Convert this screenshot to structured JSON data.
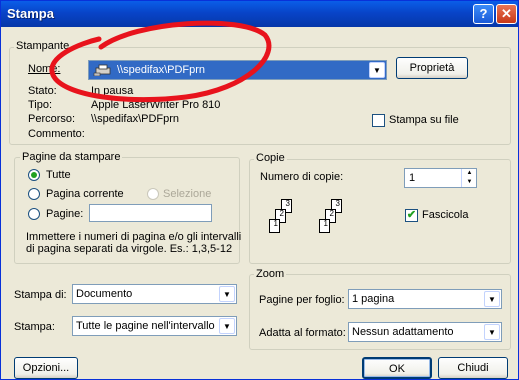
{
  "window": {
    "title": "Stampa"
  },
  "titlebar": {
    "help": "?",
    "close": "✕"
  },
  "printer": {
    "group_label": "Stampante",
    "name_label": "Nome:",
    "name_value": "\\\\spedifax\\PDFprn",
    "properties_button": "Proprietà",
    "status_label": "Stato:",
    "status_value": "In pausa",
    "type_label": "Tipo:",
    "type_value": "Apple LaserWriter Pro 810",
    "path_label": "Percorso:",
    "path_value": "\\\\spedifax\\PDFprn",
    "comment_label": "Commento:",
    "print_to_file_label": "Stampa su file",
    "print_to_file_checked": false
  },
  "range": {
    "group_label": "Pagine da stampare",
    "all_label": "Tutte",
    "current_page_label": "Pagina corrente",
    "selection_label": "Selezione",
    "pages_label": "Pagine:",
    "pages_value": "",
    "hint_line1": "Immettere i numeri di pagina e/o gli intervalli",
    "hint_line2": "di pagina separati da virgole. Es.: 1,3,5-12",
    "selected": "all"
  },
  "copies": {
    "group_label": "Copie",
    "count_label": "Numero di copie:",
    "count_value": "1",
    "collate_label": "Fascicola",
    "collate_checked": true,
    "page_numbers": [
      "1",
      "2",
      "3"
    ]
  },
  "print_what": {
    "label": "Stampa di:",
    "value": "Documento"
  },
  "print_option": {
    "label": "Stampa:",
    "value": "Tutte le pagine nell'intervallo"
  },
  "zoom": {
    "group_label": "Zoom",
    "pages_per_sheet_label": "Pagine per foglio:",
    "pages_per_sheet_value": "1 pagina",
    "scale_label": "Adatta al formato:",
    "scale_value": "Nessun adattamento"
  },
  "buttons": {
    "options": "Opzioni...",
    "ok": "OK",
    "cancel": "Chiudi"
  },
  "annotation": {
    "color": "#e8131c"
  }
}
